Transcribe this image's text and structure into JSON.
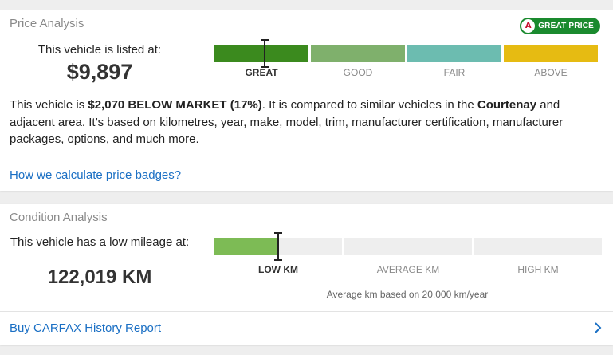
{
  "price_analysis": {
    "title": "Price Analysis",
    "badge_text": "GREAT PRICE",
    "badge_icon": "carfax-logo-icon",
    "listed_label": "This vehicle is listed at:",
    "price": "$9,897",
    "segments": [
      {
        "label": "GREAT",
        "color": "#3b8a1e",
        "active": true
      },
      {
        "label": "GOOD",
        "color": "#7fb06c",
        "active": false
      },
      {
        "label": "FAIR",
        "color": "#6cbcb0",
        "active": false
      },
      {
        "label": "ABOVE",
        "color": "#e6bb12",
        "active": false
      }
    ],
    "marker_fraction_of_bar": 0.13,
    "desc_prefix": "This vehicle is ",
    "desc_below": "$2,070 BELOW MARKET (17%)",
    "desc_mid": ". It is compared to similar vehicles in the ",
    "desc_city": "Courtenay",
    "desc_suffix": " and adjacent area. It’s based on kilometres, year, make, model, trim, manufacturer certification, manufacturer packages, options, and much more.",
    "link": "How we calculate price badges?"
  },
  "condition_analysis": {
    "title": "Condition Analysis",
    "mileage_label": "This vehicle has a low mileage at:",
    "mileage": "122,019 KM",
    "segments": [
      {
        "label": "LOW KM",
        "active": true,
        "fill": 0.5,
        "fill_color": "#7dbb55"
      },
      {
        "label": "AVERAGE KM",
        "active": false
      },
      {
        "label": "HIGH KM",
        "active": false
      }
    ],
    "avg_note": "Average km based on 20,000 km/year",
    "footer_link": "Buy CARFAX History Report",
    "footer_icon": "chevron-right-icon"
  }
}
